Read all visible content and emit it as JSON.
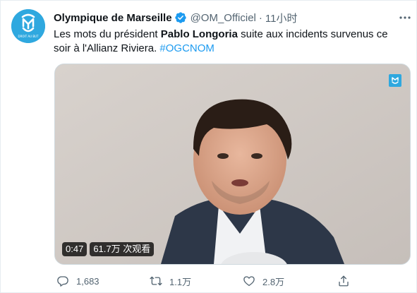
{
  "account": {
    "display_name": "Olympique de Marseille",
    "handle": "@OM_Officiel",
    "separator": "·",
    "time": "11小时",
    "avatar_text": "DROIT AU BUT"
  },
  "tweet": {
    "text_prefix": "Les mots du président ",
    "text_bold": "Pablo Longoria",
    "text_suffix": " suite aux incidents survenus ce soir à l'Allianz Riviera. ",
    "hashtag": "#OGCNOM"
  },
  "video": {
    "duration": "0:47",
    "views": "61.7万 次观看"
  },
  "actions": {
    "replies": "1,683",
    "retweets": "1.1万",
    "likes": "2.8万"
  },
  "colors": {
    "accent": "#1d9bf0",
    "brand": "#2fa8df",
    "secondary_text": "#536471"
  },
  "icons": [
    "om-logo-icon",
    "verified-badge-icon",
    "more-icon",
    "reply-icon",
    "retweet-icon",
    "like-icon",
    "share-icon"
  ]
}
